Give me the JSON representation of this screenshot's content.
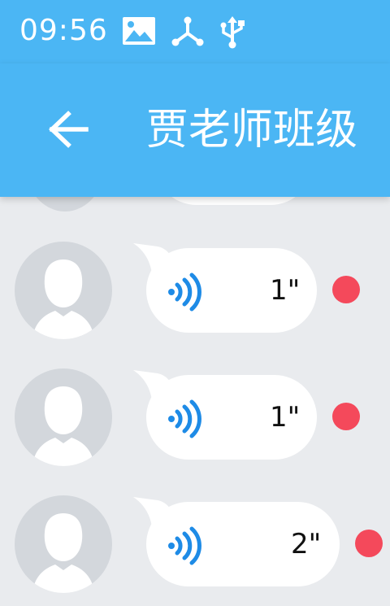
{
  "status_bar": {
    "time": "09:56",
    "icons": [
      "image-icon",
      "network-share-icon",
      "usb-icon"
    ]
  },
  "app_bar": {
    "title": "贾老师班级",
    "back_icon": "arrow-left-icon"
  },
  "colors": {
    "header": "#4bb6f4",
    "background": "#e9ebee",
    "bubble": "#ffffff",
    "voice_icon": "#1e8be6",
    "unread_dot": "#f4495b",
    "avatar": "#d3d7dc"
  },
  "messages": [
    {
      "type": "voice",
      "duration": "1\"",
      "unread": true
    },
    {
      "type": "voice",
      "duration": "1\"",
      "unread": true
    },
    {
      "type": "voice",
      "duration": "2\"",
      "unread": true
    }
  ]
}
